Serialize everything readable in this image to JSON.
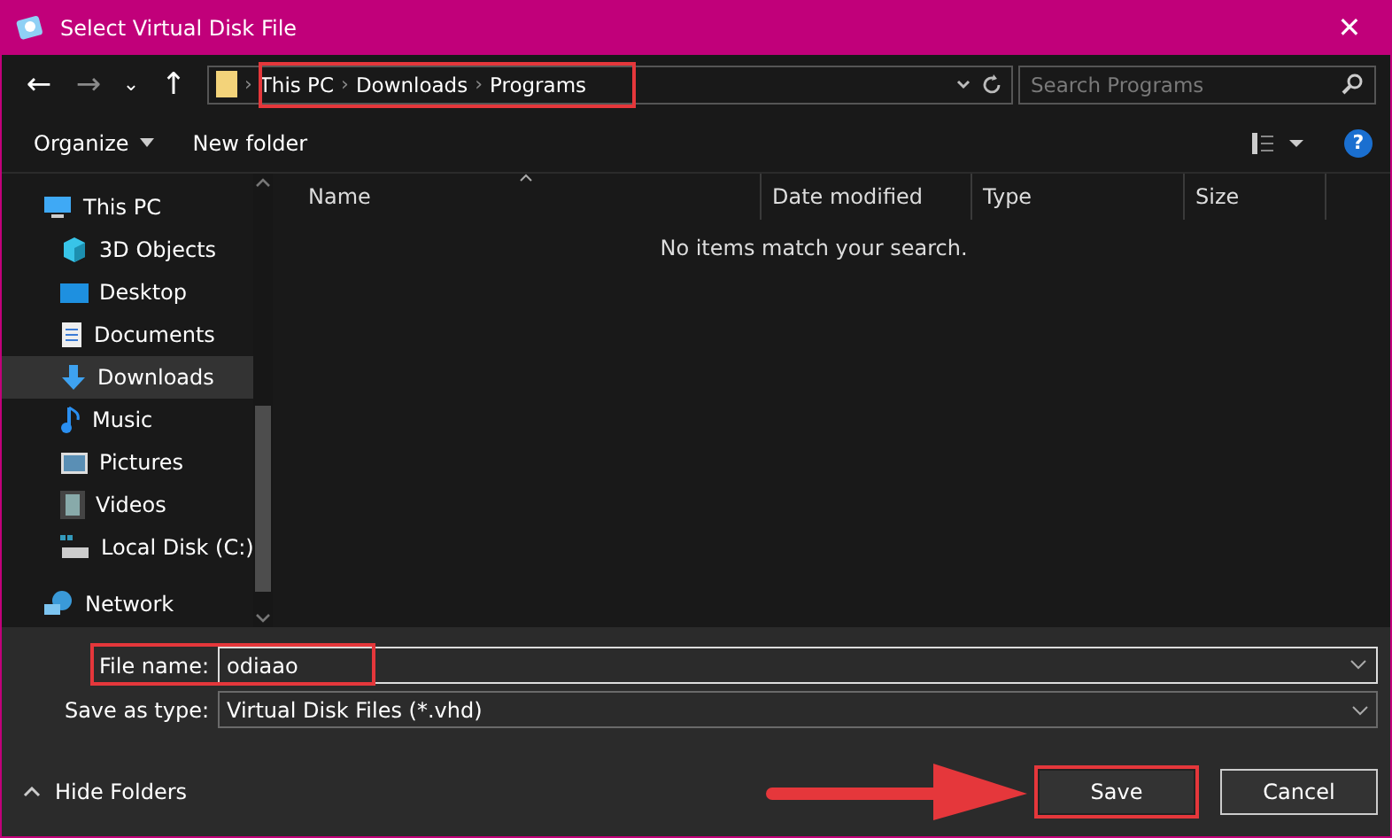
{
  "window": {
    "title": "Select Virtual Disk File",
    "close": "✕"
  },
  "nav": {
    "back": "←",
    "forward": "→",
    "recent": "⌄",
    "up": "↑",
    "path": [
      "This PC",
      "Downloads",
      "Programs"
    ],
    "separator": "›",
    "search_placeholder": "Search Programs"
  },
  "toolbar": {
    "organize": "Organize",
    "new_folder": "New folder",
    "help": "?"
  },
  "sidebar": {
    "items": [
      {
        "label": "This PC",
        "kind": "pc",
        "selected": false,
        "children": [
          {
            "label": "3D Objects",
            "kind": "cube",
            "selected": false
          },
          {
            "label": "Desktop",
            "kind": "desktop",
            "selected": false
          },
          {
            "label": "Documents",
            "kind": "document",
            "selected": false
          },
          {
            "label": "Downloads",
            "kind": "download",
            "selected": true
          },
          {
            "label": "Music",
            "kind": "music",
            "selected": false
          },
          {
            "label": "Pictures",
            "kind": "picture",
            "selected": false
          },
          {
            "label": "Videos",
            "kind": "video",
            "selected": false
          },
          {
            "label": "Local Disk (C:)",
            "kind": "disk",
            "selected": false
          }
        ]
      },
      {
        "label": "Network",
        "kind": "network",
        "selected": false
      }
    ]
  },
  "table": {
    "columns": [
      "Name",
      "Date modified",
      "Type",
      "Size"
    ],
    "empty_message": "No items match your search."
  },
  "form": {
    "file_name_label": "File name:",
    "file_name_value": "odiaao",
    "type_label": "Save as type:",
    "type_value": "Virtual Disk Files (*.vhd)"
  },
  "footer": {
    "hide_folders": "Hide Folders",
    "buttons": [
      "Save",
      "Cancel"
    ]
  }
}
